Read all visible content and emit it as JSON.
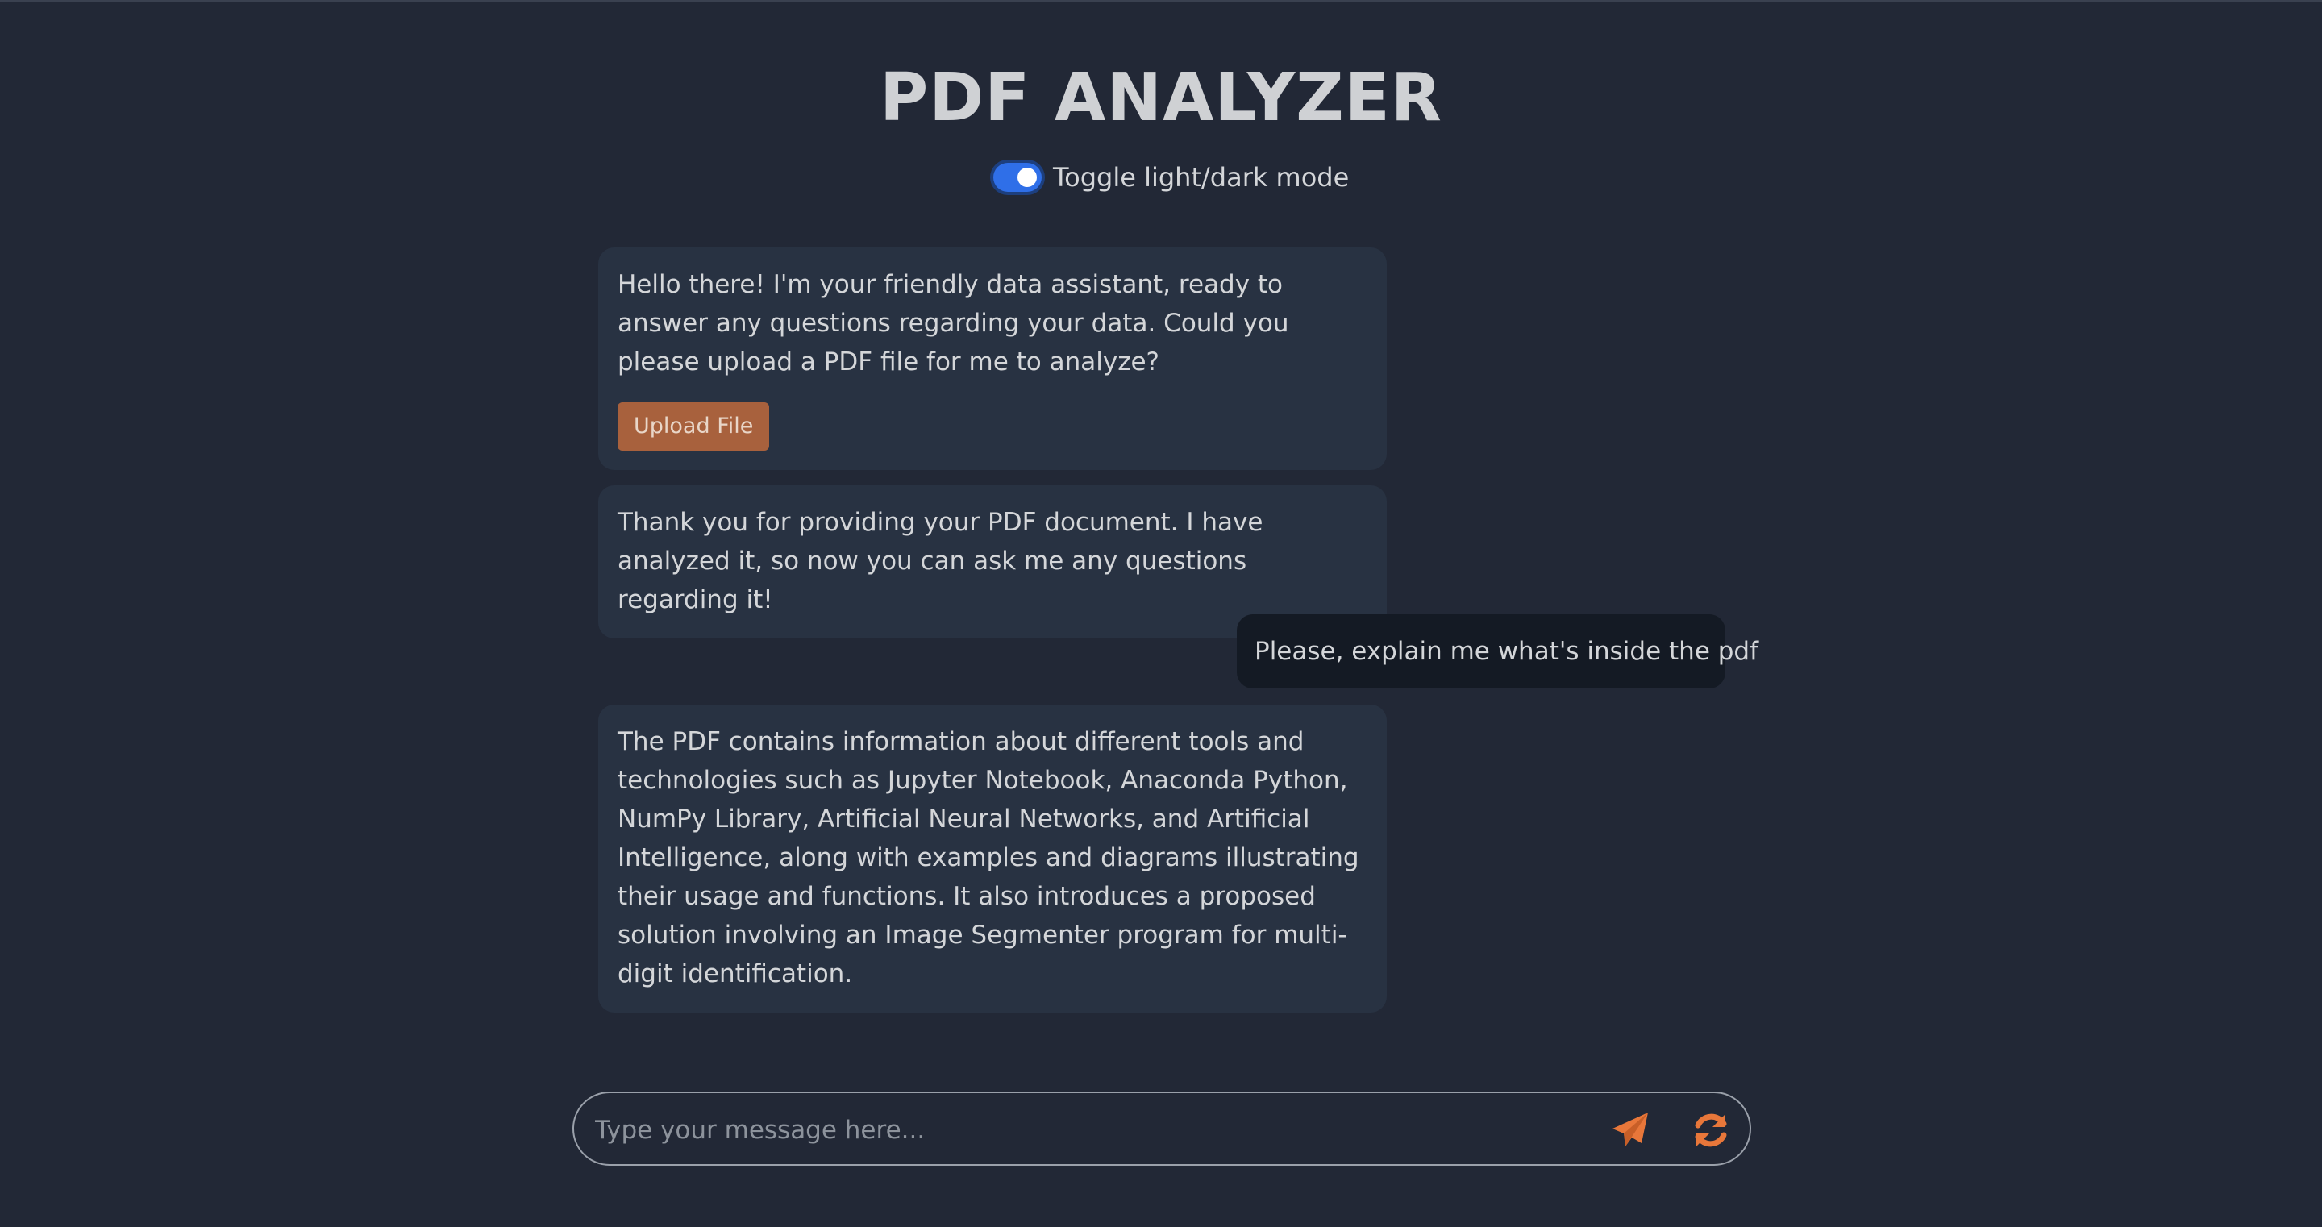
{
  "header": {
    "title": "PDF ANALYZER",
    "toggle_label": "Toggle light/dark mode"
  },
  "messages": [
    {
      "role": "assistant",
      "text": "Hello there! I'm your friendly data assistant, ready to answer any questions regarding your data. Could you please upload a PDF file for me to analyze?",
      "button_label": "Upload File"
    },
    {
      "role": "assistant",
      "text": "Thank you for providing your PDF document. I have analyzed it, so now you can ask me any questions regarding it!"
    },
    {
      "role": "user",
      "text": "Please, explain me what's inside the pdf"
    },
    {
      "role": "assistant",
      "text": "The PDF contains information about different tools and technologies such as Jupyter Notebook, Anaconda Python, NumPy Library, Artificial Neural Networks, and Artificial Intelligence, along with examples and diagrams illustrating their usage and functions. It also introduces a proposed solution involving an Image Segmenter program for multi-digit identification."
    }
  ],
  "composer": {
    "placeholder": "Type your message here...",
    "value": "",
    "send_icon": "paper-plane-icon",
    "refresh_icon": "refresh-icon"
  },
  "colors": {
    "background": "#222836",
    "bot_bubble": "#283242",
    "user_bubble": "#141a24",
    "accent": "#e8773a",
    "upload_button": "#a8613d",
    "toggle": "#2f6fe8"
  }
}
